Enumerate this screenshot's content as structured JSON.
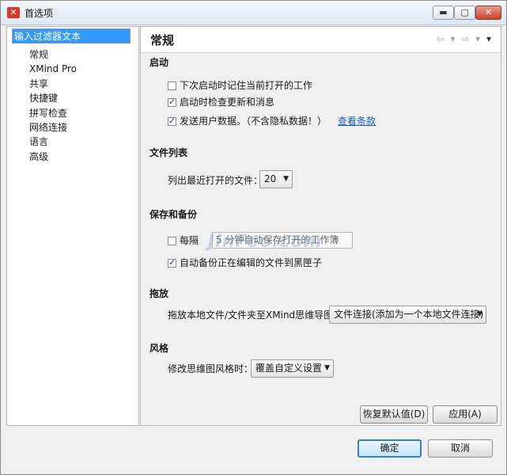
{
  "window": {
    "title": "首选项",
    "buttons": {
      "minimize": "▬",
      "maximize": "▢",
      "close": "✕"
    }
  },
  "sidebar": {
    "filter_value": "输入过滤器文本",
    "items": [
      {
        "label": "常规"
      },
      {
        "label": "XMind Pro"
      },
      {
        "label": "共享"
      },
      {
        "label": "快捷键"
      },
      {
        "label": "拼写检查"
      },
      {
        "label": "网络连接"
      },
      {
        "label": "语言"
      },
      {
        "label": "高级"
      }
    ]
  },
  "page": {
    "title": "常规",
    "nav": {
      "back": "⇦ ▾",
      "forward": "⇨ ▾",
      "menu": "▾"
    },
    "startup": {
      "heading": "启动",
      "opt1_label": "下次启动时记住当前打开的工作",
      "opt1_checked": false,
      "opt2_label": "启动时检查更新和消息",
      "opt2_checked": true,
      "opt3_label": "发送用户数据。（不含隐私数据！）",
      "opt3_checked": true,
      "opt3_link": "查看条款"
    },
    "filelist": {
      "heading": "文件列表",
      "label": "列出最近打开的文件：",
      "value": "20"
    },
    "backup": {
      "heading": "保存和备份",
      "autosave_label": "每隔",
      "autosave_checked": false,
      "autosave_field": "5 分钟自动保存打开的工作簿",
      "autobackup_label": "自动备份正在编辑的文件到黑匣子",
      "autobackup_checked": true
    },
    "dragdrop": {
      "heading": "拖放",
      "label": "拖放本地文件/文件夹至XMind思维导图:",
      "value": "文件连接(添加为一个本地文件连接)"
    },
    "style": {
      "heading": "风格",
      "label": "修改思维图风格时：",
      "value": "覆盖自定义设置"
    },
    "restore_defaults_label": "恢复默认值(D)",
    "apply_label": "应用(A)"
  },
  "footer": {
    "ok_label": "确定",
    "cancel_label": "取消"
  },
  "watermark": "JinFoo.com"
}
